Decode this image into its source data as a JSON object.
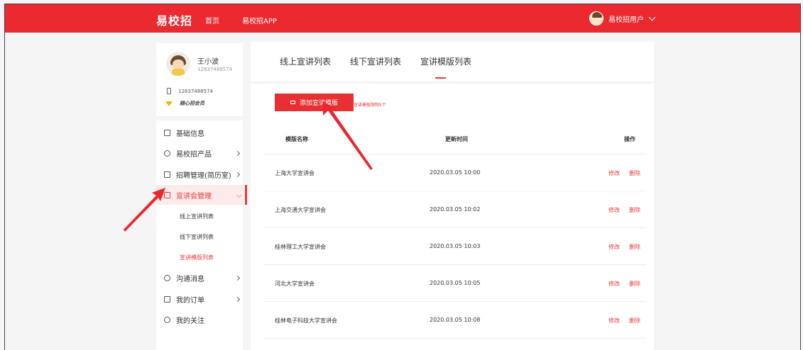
{
  "header": {
    "brand": "易校招",
    "nav": [
      "首页",
      "易校招APP"
    ],
    "user": "易校招用户"
  },
  "profile": {
    "name": "王小波",
    "phone": "12837488574",
    "phone_row": "12837488574",
    "vip": "随心招会员"
  },
  "sidebar": {
    "items": [
      {
        "label": "基础信息"
      },
      {
        "label": "易校招产品"
      },
      {
        "label": "招聘管理(简历室)"
      },
      {
        "label": "宣讲会管理"
      },
      {
        "label": "沟通消息"
      },
      {
        "label": "我的订单"
      },
      {
        "label": "我的关注"
      }
    ],
    "sub_items": [
      "线上宣讲列表",
      "线下宣讲列表",
      "宣讲模版列表"
    ]
  },
  "tabs": [
    "线上宣讲列表",
    "线下宣讲列表",
    "宣讲模版列表"
  ],
  "toolbar": {
    "add_label": "添加宣讲模版",
    "hint": "宣讲模板限制5个"
  },
  "table": {
    "headers": [
      "模版名称",
      "更新时间",
      "操作"
    ],
    "rows": [
      {
        "name": "上海大学宣讲会",
        "time": "2020.03.05  10:00",
        "edit": "修改",
        "del": "删除"
      },
      {
        "name": "上海交通大学宣讲会",
        "time": "2020.03.05  10:02",
        "edit": "修改",
        "del": "删除"
      },
      {
        "name": "桂林理工大学宣讲会",
        "time": "2020.03.05  10:03",
        "edit": "修改",
        "del": "删除"
      },
      {
        "name": "河北大学宣讲会",
        "time": "2020.03.05  10:05",
        "edit": "修改",
        "del": "删除"
      },
      {
        "name": "桂林电子科技大学宣讲会",
        "time": "2020.03.05  10:08",
        "edit": "修改",
        "del": "删除"
      }
    ]
  },
  "colors": {
    "accent": "#ea2a2f",
    "annotation": "#e8282d"
  }
}
